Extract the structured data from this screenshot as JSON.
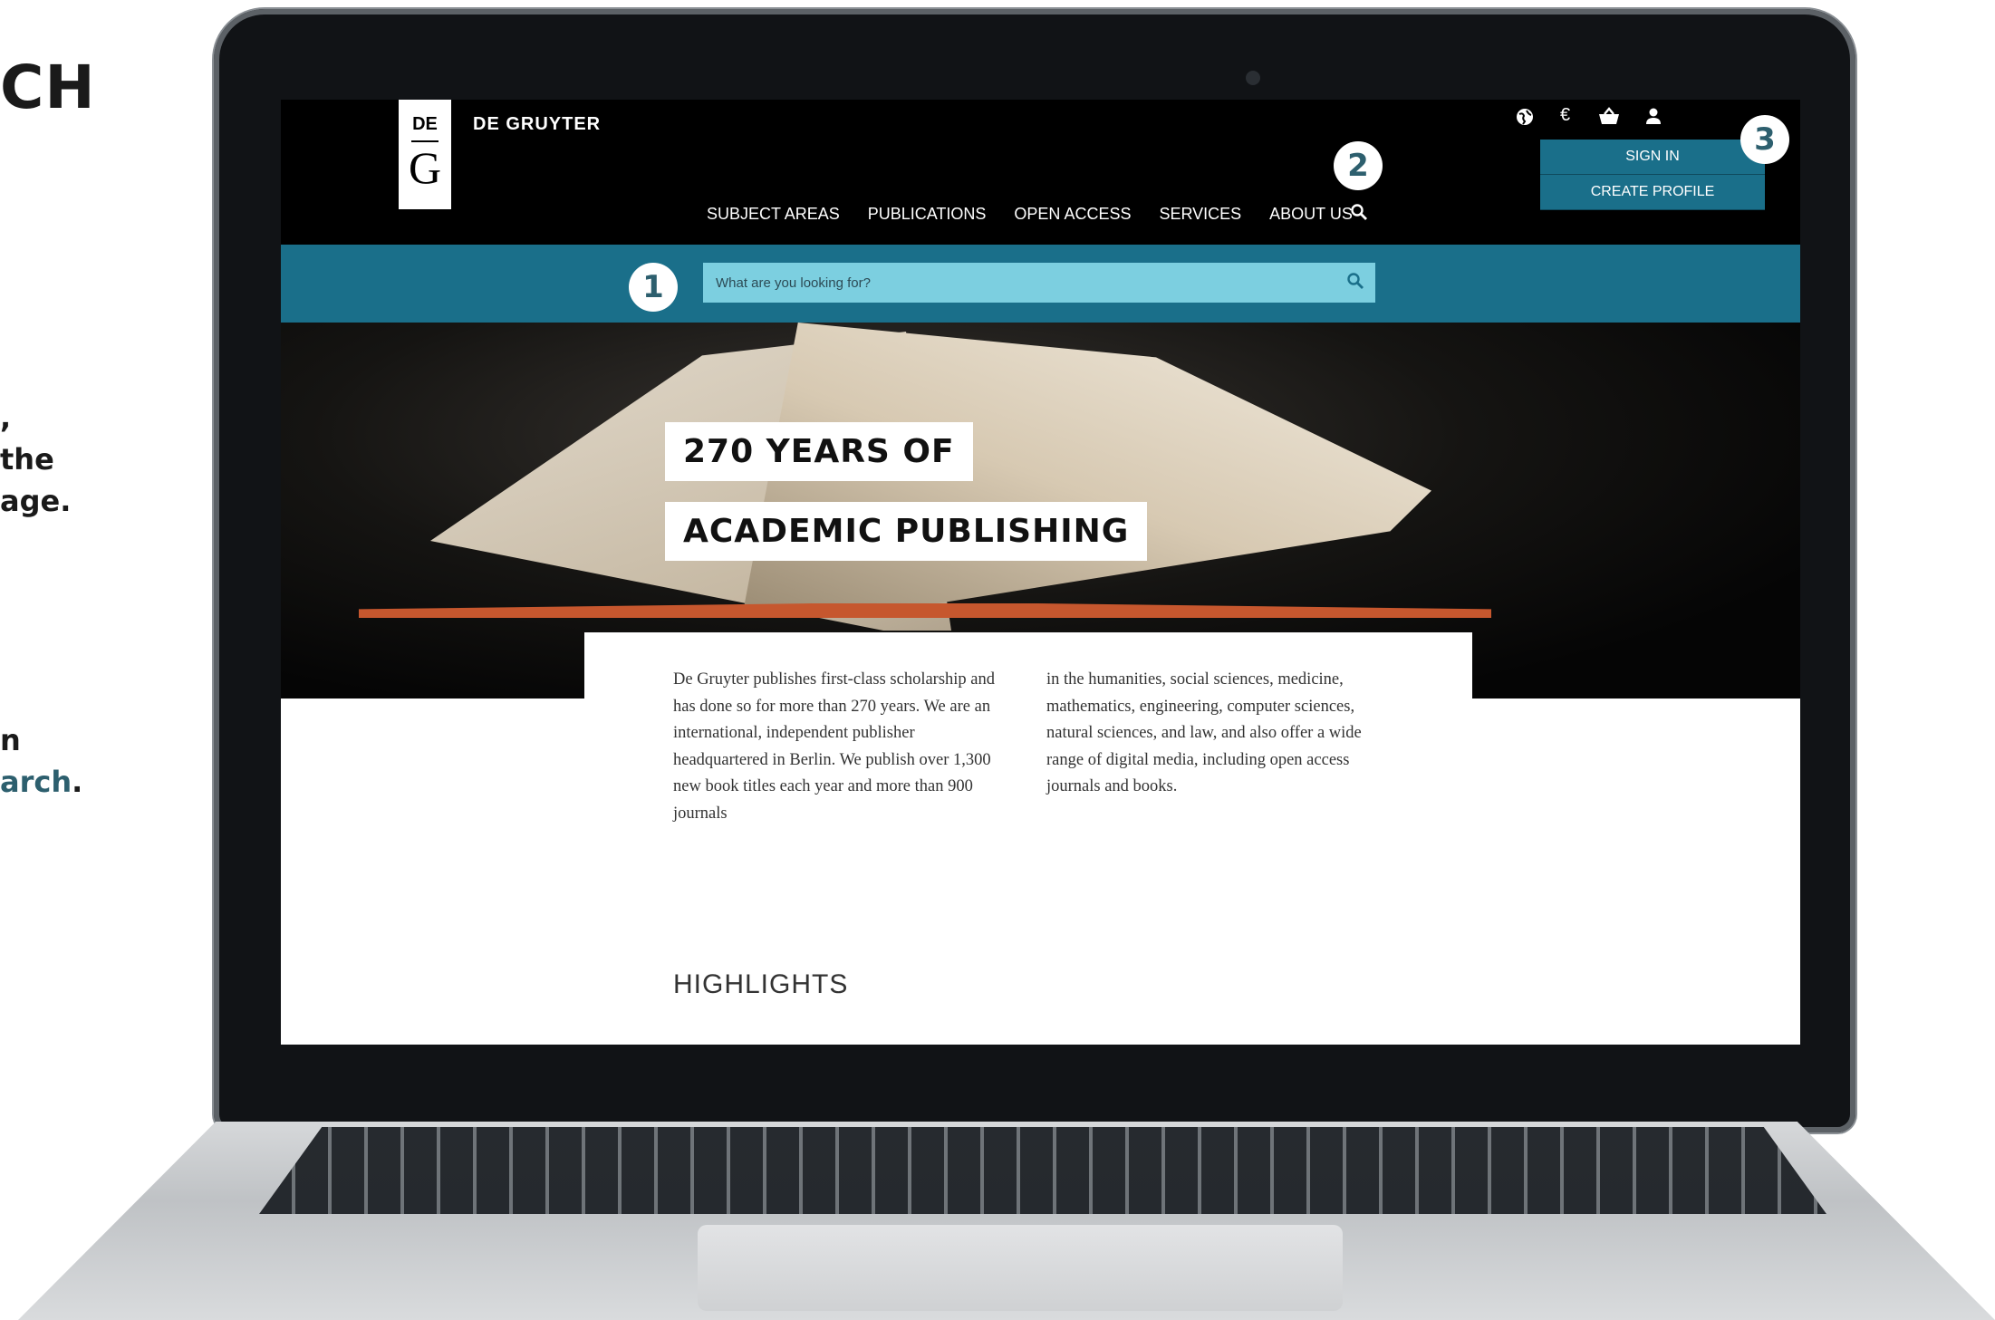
{
  "side_text": {
    "title": "CH",
    "paragraph1": [
      ",",
      "the",
      "age."
    ],
    "paragraph2_line1": "n",
    "paragraph2_line2_accent": "arch",
    "paragraph2_line2_end": "."
  },
  "site": {
    "logo_top": "DE",
    "logo_letter": "G",
    "brand": "DE GRUYTER",
    "nav": [
      "SUBJECT AREAS",
      "PUBLICATIONS",
      "OPEN ACCESS",
      "SERVICES",
      "ABOUT US"
    ],
    "account": {
      "sign_in": "SIGN IN",
      "create_profile": "CREATE PROFILE"
    },
    "search": {
      "placeholder": "What are you looking for?"
    },
    "utility_icons": [
      "globe-icon",
      "euro-icon",
      "basket-icon",
      "user-icon"
    ],
    "utility_glyphs": {
      "globe": "🌐",
      "euro": "€",
      "basket": "⛺",
      "user": "👤"
    }
  },
  "badges": [
    "1",
    "2",
    "3"
  ],
  "hero": {
    "line1": "270 YEARS OF",
    "line2": "ACADEMIC PUBLISHING"
  },
  "intro": {
    "col1": "De Gruyter publishes first-class scholarship and has done so for more than 270 years. We are an international, independent publisher headquartered in Berlin. We publish over 1,300 new book titles each year and more than 900 journals",
    "col2": "in the humanities, social sciences, medicine, mathematics, engineering, computer sciences, natural sciences, and law, and also offer a wide range of digital media, including open access journals and books."
  },
  "highlights_heading": "HIGHLIGHTS",
  "colors": {
    "teal_dark": "#1a6f8a",
    "teal_light": "#7ccfe0",
    "accent_text": "#2d5f6e"
  }
}
